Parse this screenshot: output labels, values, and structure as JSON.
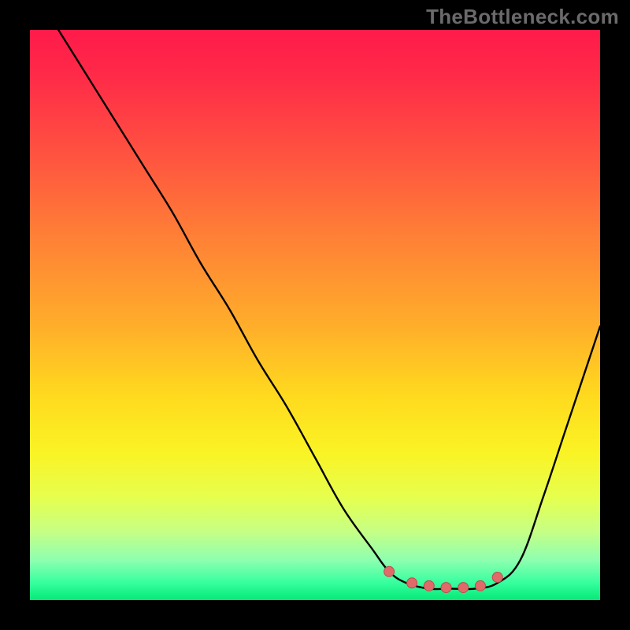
{
  "watermark": "TheBottleneck.com",
  "colors": {
    "curve": "#000000",
    "dot_fill": "#e06a6a",
    "dot_stroke": "#c24a4a",
    "gradient_top": "#ff1a4a",
    "gradient_bottom": "#06e877"
  },
  "chart_data": {
    "type": "line",
    "title": "",
    "xlabel": "",
    "ylabel": "",
    "xlim": [
      0,
      100
    ],
    "ylim": [
      0,
      100
    ],
    "note": "Y is inverted visually (0 at bottom, 100 at top). Curve read from pixel heights; axis has no ticks.",
    "x": [
      5,
      10,
      15,
      20,
      25,
      30,
      35,
      40,
      45,
      50,
      55,
      60,
      63,
      66,
      70,
      74,
      78,
      82,
      86,
      90,
      94,
      100
    ],
    "y": [
      100,
      92,
      84,
      76,
      68,
      59,
      51,
      42,
      34,
      25,
      16,
      9,
      5,
      3,
      2,
      2,
      2,
      3,
      7,
      18,
      30,
      48
    ],
    "flat_region_x": [
      63,
      82
    ],
    "dots": [
      {
        "x": 63,
        "y": 5
      },
      {
        "x": 67,
        "y": 3
      },
      {
        "x": 70,
        "y": 2.5
      },
      {
        "x": 73,
        "y": 2.2
      },
      {
        "x": 76,
        "y": 2.2
      },
      {
        "x": 79,
        "y": 2.5
      },
      {
        "x": 82,
        "y": 4
      }
    ]
  }
}
